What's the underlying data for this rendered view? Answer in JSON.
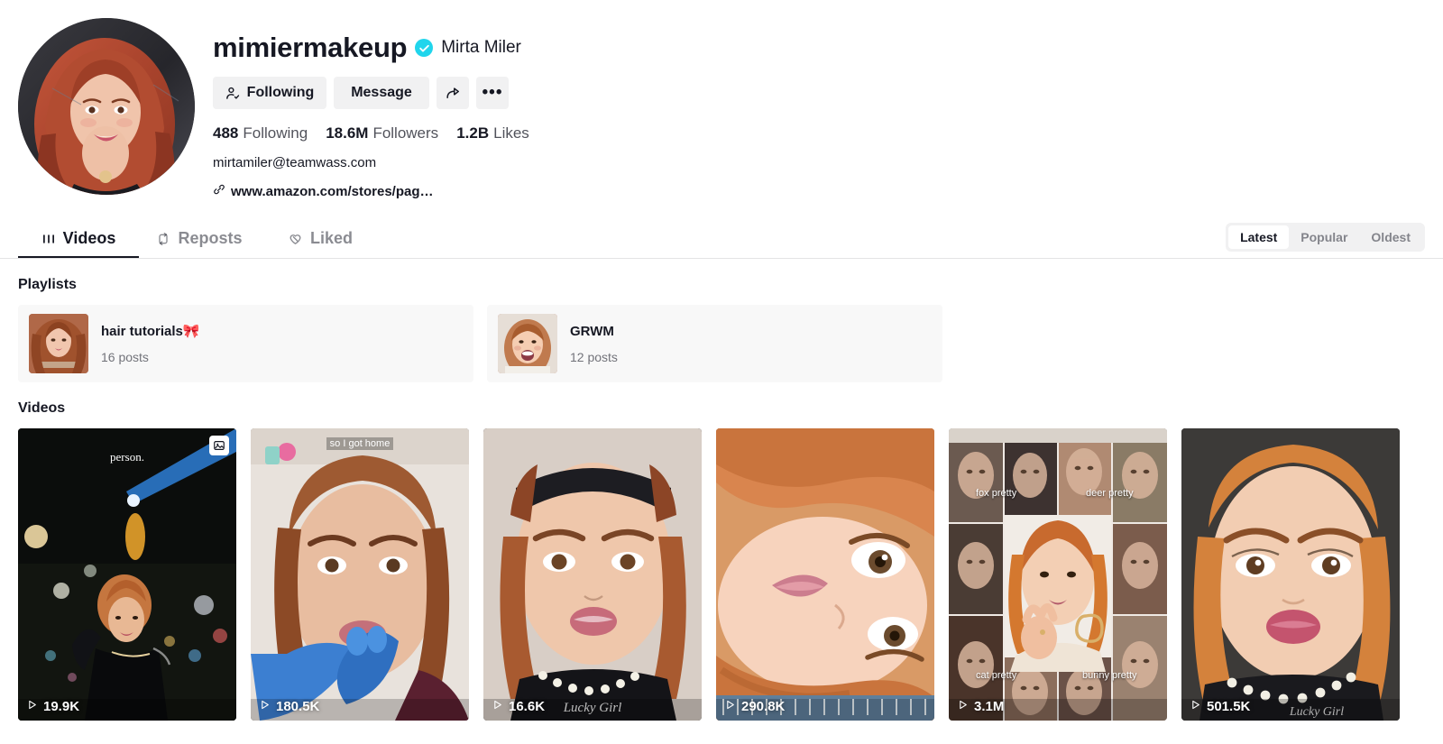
{
  "profile": {
    "username": "mimiermakeup",
    "nickname": "Mirta Miler",
    "verified_icon": "verified-check-icon",
    "buttons": {
      "following": "Following",
      "message": "Message",
      "share_icon": "share-arrow-icon",
      "more_icon": "more-options-icon"
    },
    "stats": {
      "following_count": "488",
      "following_label": "Following",
      "followers_count": "18.6M",
      "followers_label": "Followers",
      "likes_count": "1.2B",
      "likes_label": "Likes"
    },
    "bio_email": "mirtamiler@teamwass.com",
    "bio_link": "www.amazon.com/stores/pag…",
    "bio_link_icon": "link-icon"
  },
  "tabs": [
    {
      "label": "Videos",
      "icon": "grid-bars-icon",
      "active": true
    },
    {
      "label": "Reposts",
      "icon": "repost-arrows-icon",
      "active": false
    },
    {
      "label": "Liked",
      "icon": "heart-hidden-icon",
      "active": false
    }
  ],
  "sort": {
    "options": [
      "Latest",
      "Popular",
      "Oldest"
    ],
    "selected": "Latest"
  },
  "sections": {
    "playlists_title": "Playlists",
    "videos_title": "Videos"
  },
  "playlists": [
    {
      "name": "hair tutorials🎀",
      "posts": "16 posts"
    },
    {
      "name": "GRWM",
      "posts": "12 posts"
    }
  ],
  "videos": [
    {
      "views": "19.9K",
      "caption": "person.",
      "multi_image": true,
      "play_icon": "play-triangle-icon"
    },
    {
      "views": "180.5K",
      "caption": "so I got home",
      "multi_image": false,
      "play_icon": "play-triangle-icon"
    },
    {
      "views": "16.6K",
      "caption": "",
      "multi_image": false,
      "play_icon": "play-triangle-icon"
    },
    {
      "views": "290.8K",
      "caption": "",
      "multi_image": false,
      "play_icon": "play-triangle-icon"
    },
    {
      "views": "3.1M",
      "caption": "",
      "multi_image": false,
      "play_icon": "play-triangle-icon",
      "collage_labels": [
        "fox pretty",
        "deer pretty",
        "cat pretty",
        "bunny pretty"
      ]
    },
    {
      "views": "501.5K",
      "caption": "",
      "multi_image": false,
      "play_icon": "play-triangle-icon"
    }
  ],
  "colors": {
    "verified_blue": "#20D5EC",
    "button_grey": "#F1F1F2",
    "card_grey": "#F8F8F8",
    "text_primary": "#161823"
  }
}
